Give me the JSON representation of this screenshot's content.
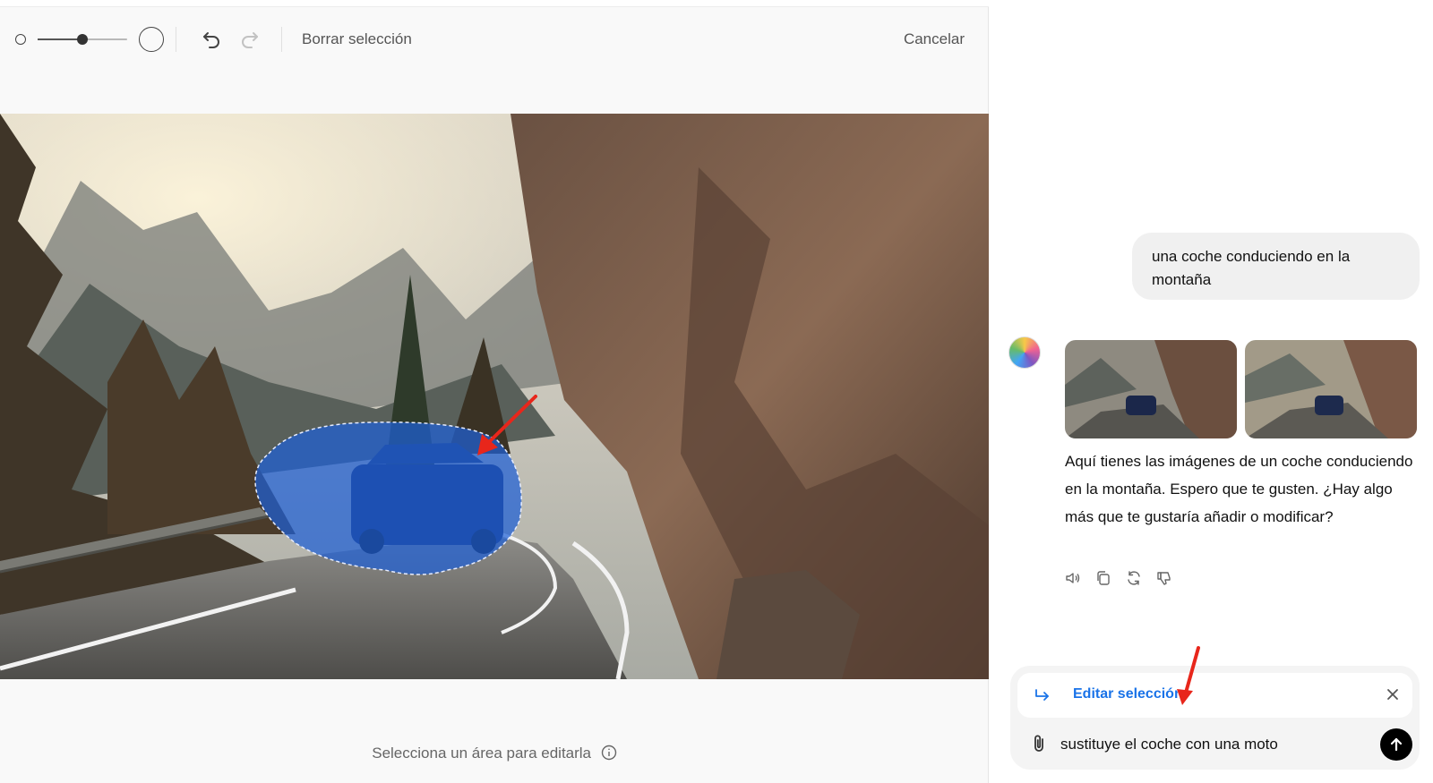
{
  "toolbar": {
    "clear_selection": "Borrar selección",
    "cancel": "Cancelar",
    "brush_size_level": 0.5
  },
  "hint": {
    "text": "Selecciona un área para editarla"
  },
  "chat": {
    "user_message": "una coche conduciendo en la montaña",
    "assistant_message": "Aquí tienes las imágenes de un coche conduciendo en la montaña. Espero que te gusten. ¿Hay algo más que te gustaría añadir o modificar?",
    "thumbnails": [
      "thumb-1",
      "thumb-2"
    ],
    "actions": [
      "speaker-icon",
      "copy-icon",
      "regenerate-icon",
      "thumbs-down-icon"
    ]
  },
  "composer": {
    "edit_label": "Editar selección",
    "input_value": "sustituye el coche con una moto"
  },
  "colors": {
    "selection_mask": "#1e5fd6",
    "link_blue": "#1a73e8",
    "annotation_red": "#e8261b"
  }
}
